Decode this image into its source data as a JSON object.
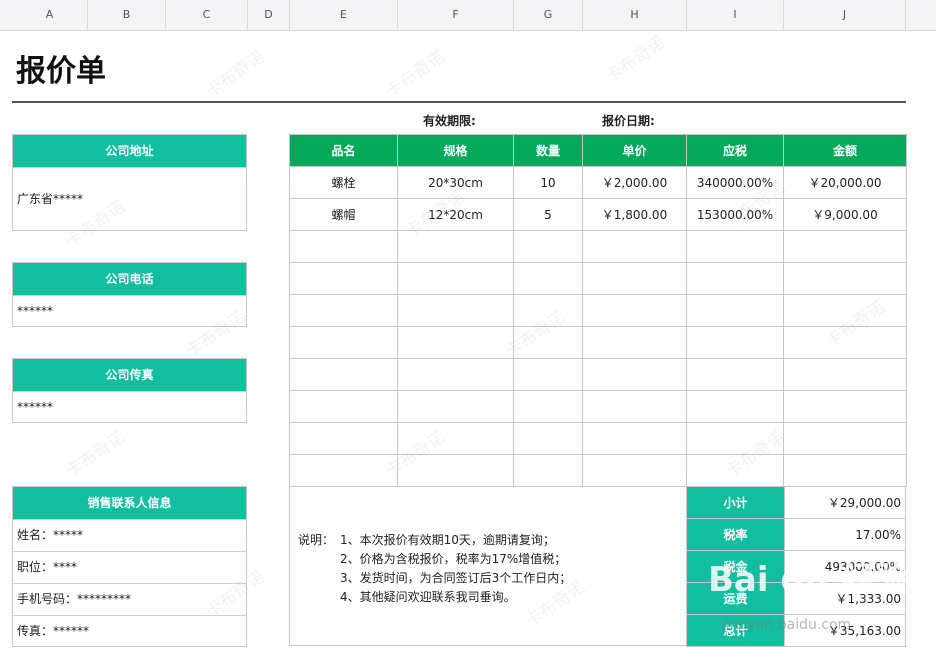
{
  "columns": [
    "A",
    "B",
    "C",
    "D",
    "E",
    "F",
    "G",
    "H",
    "I",
    "J"
  ],
  "title": "报价单",
  "validity_label": "有效期限:",
  "quote_date_label": "报价日期:",
  "company_address": {
    "label": "公司地址",
    "value": "广东省*****"
  },
  "company_phone": {
    "label": "公司电话",
    "value": "******"
  },
  "company_fax": {
    "label": "公司传真",
    "value": "******"
  },
  "sales_contact": {
    "label": "销售联系人信息",
    "rows": [
      "姓名：*****",
      "职位：****",
      "手机号码：*********",
      "传真：******"
    ]
  },
  "items_table": {
    "headers": [
      "品名",
      "规格",
      "数量",
      "单价",
      "应税",
      "金额"
    ],
    "rows": [
      [
        "螺栓",
        "20*30cm",
        "10",
        "￥2,000.00",
        "340000.00%",
        "￥20,000.00"
      ],
      [
        "螺帽",
        "12*20cm",
        "5",
        "￥1,800.00",
        "153000.00%",
        "￥9,000.00"
      ]
    ]
  },
  "notes": {
    "prefix": "说明：",
    "lines": [
      "1、本次报价有效期10天，逾期请复询；",
      "2、价格为含税报价，税率为17%增值税；",
      "3、发货时间，为合同签订后3个工作日内；",
      "4、其他疑问欢迎联系我司垂询。"
    ]
  },
  "summary": [
    {
      "label": "小计",
      "value": "￥29,000.00"
    },
    {
      "label": "税率",
      "value": "17.00%"
    },
    {
      "label": "税金",
      "value": "493000.00%"
    },
    {
      "label": "运费",
      "value": "￥1,333.00"
    },
    {
      "label": "总计",
      "value": "￥35,163.00"
    }
  ],
  "watermark": "卡布奇诺",
  "overlay_logo": "Bai du 经验",
  "overlay_url": "jingyan.baidu.com"
}
